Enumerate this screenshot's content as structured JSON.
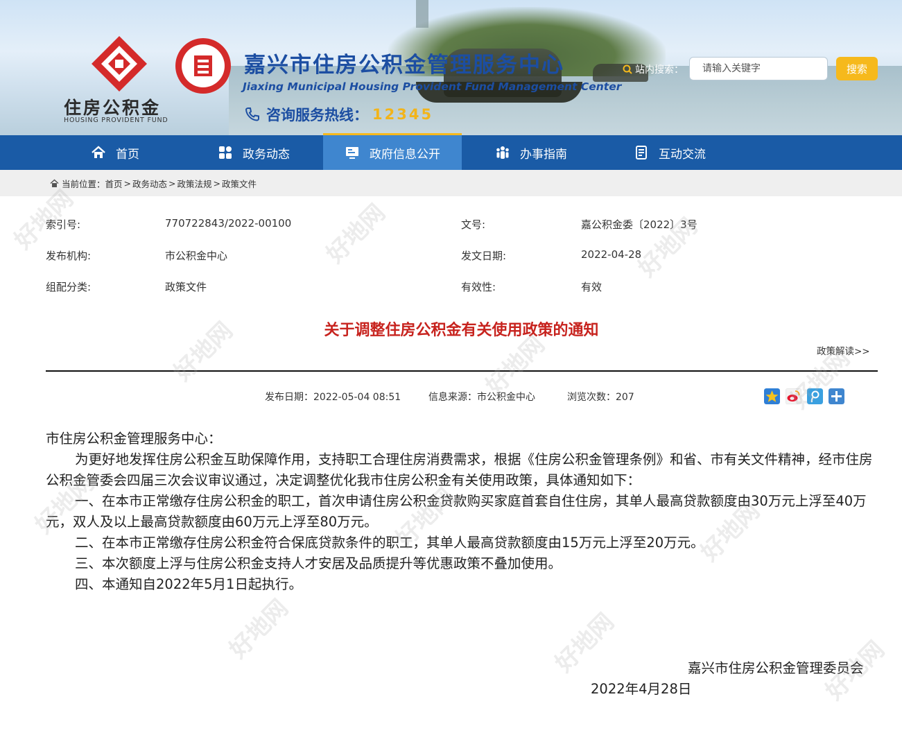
{
  "logo": {
    "name_cn": "住房公积金",
    "name_en": "HOUSING PROVIDENT FUND"
  },
  "site": {
    "title_cn": "嘉兴市住房公积金管理服务中心",
    "title_en": "Jiaxing Municipal Housing Provident Fund Management Center",
    "hotline_label": "咨询服务热线：",
    "hotline_number": "12345"
  },
  "search": {
    "label": "站内搜索：",
    "placeholder": "请输入关键字",
    "button_label": "搜索"
  },
  "nav": {
    "items": [
      {
        "label": "首页",
        "icon": "home-icon"
      },
      {
        "label": "政务动态",
        "icon": "grid-icon"
      },
      {
        "label": "政府信息公开",
        "icon": "monitor-icon",
        "active": true
      },
      {
        "label": "办事指南",
        "icon": "people-icon"
      },
      {
        "label": "互动交流",
        "icon": "document-icon"
      }
    ]
  },
  "breadcrumb": {
    "prefix": "当前位置：",
    "items": [
      "首页",
      "政务动态",
      "政策法规",
      "政策文件"
    ],
    "separator": ">"
  },
  "meta": {
    "index_label": "索引号:",
    "index_value": "770722843/2022-00100",
    "doc_no_label": "文号:",
    "doc_no_value": "嘉公积金委〔2022〕3号",
    "publisher_label": "发布机构:",
    "publisher_value": "市公积金中心",
    "issue_date_label": "发文日期:",
    "issue_date_value": "2022-04-28",
    "category_label": "组配分类:",
    "category_value": "政策文件",
    "validity_label": "有效性:",
    "validity_value": "有效"
  },
  "article": {
    "title": "关于调整住房公积金有关使用政策的通知",
    "interpretation_link": "政策解读>>",
    "publish_date_label": "发布日期：",
    "publish_date": "2022-05-04 08:51",
    "source_label": "信息来源：",
    "source": "市公积金中心",
    "views_label": "浏览次数：",
    "views": "207",
    "salutation": "市住房公积金管理服务中心：",
    "paragraphs": [
      "为更好地发挥住房公积金互助保障作用，支持职工合理住房消费需求，根据《住房公积金管理条例》和省、市有关文件精神，经市住房公积金管委会四届三次会议审议通过，决定调整优化我市住房公积金有关使用政策，具体通知如下：",
      "一、在本市正常缴存住房公积金的职工，首次申请住房公积金贷款购买家庭首套自住住房，其单人最高贷款额度由30万元上浮至40万元，双人及以上最高贷款额度由60万元上浮至80万元。",
      "二、在本市正常缴存住房公积金符合保底贷款条件的职工，其单人最高贷款额度由15万元上浮至20万元。",
      "三、本次额度上浮与住房公积金支持人才安居及品质提升等优惠政策不叠加使用。",
      "四、本通知自2022年5月1日起执行。"
    ],
    "signature_org": "嘉兴市住房公积金管理委员会",
    "signature_date": "2022年4月28日"
  },
  "share_icons": [
    "favorite-star-icon",
    "weibo-icon",
    "tencent-weibo-icon",
    "more-share-icon"
  ],
  "watermark": {
    "text": "好地网"
  },
  "colors": {
    "nav_bg": "#1a5ba6",
    "nav_active": "#3f86cf",
    "accent_yellow": "#f6b91c",
    "title_red": "#c7231e",
    "brand_blue": "#1c4ea2"
  }
}
